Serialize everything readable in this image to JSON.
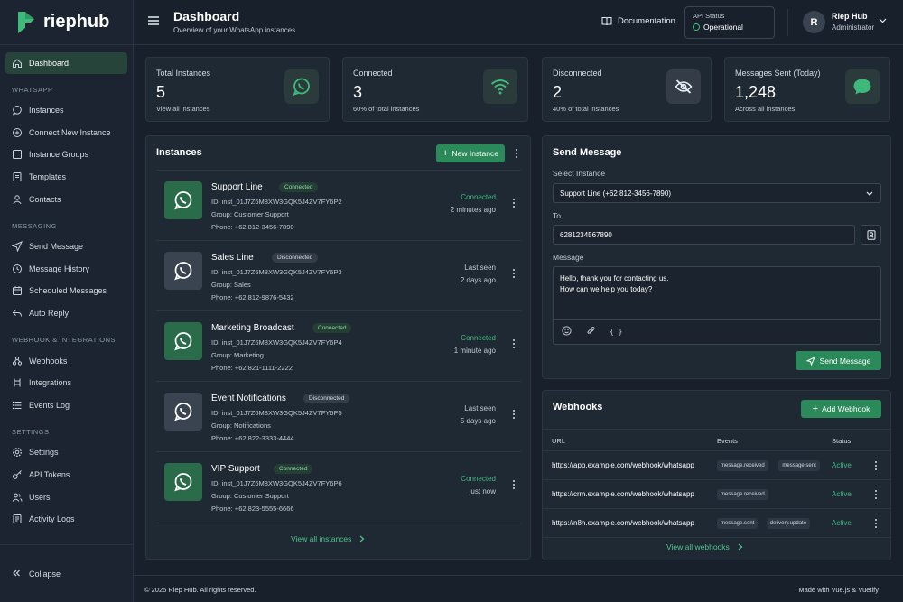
{
  "brand": {
    "name": "riephub",
    "accent": "#3fb97a"
  },
  "sidebar": {
    "items": [
      {
        "label": "Dashboard",
        "icon": "home-icon",
        "active": true
      }
    ],
    "sections": [
      {
        "title": "WHATSAPP",
        "items": [
          {
            "label": "Instances",
            "icon": "whatsapp-icon"
          },
          {
            "label": "Connect New Instance",
            "icon": "plus-circle-icon"
          },
          {
            "label": "Instance Groups",
            "icon": "folder-icon"
          },
          {
            "label": "Templates",
            "icon": "template-icon"
          },
          {
            "label": "Contacts",
            "icon": "user-icon"
          }
        ]
      },
      {
        "title": "MESSAGING",
        "items": [
          {
            "label": "Send Message",
            "icon": "send-icon"
          },
          {
            "label": "Message History",
            "icon": "history-icon"
          },
          {
            "label": "Scheduled Messages",
            "icon": "calendar-icon"
          },
          {
            "label": "Auto Reply",
            "icon": "reply-icon"
          }
        ]
      },
      {
        "title": "WEBHOOK & INTEGRATIONS",
        "items": [
          {
            "label": "Webhooks",
            "icon": "webhook-icon"
          },
          {
            "label": "Integrations",
            "icon": "integration-icon"
          },
          {
            "label": "Events Log",
            "icon": "list-icon"
          }
        ]
      },
      {
        "title": "SETTINGS",
        "items": [
          {
            "label": "Settings",
            "icon": "gear-icon"
          },
          {
            "label": "API Tokens",
            "icon": "key-icon"
          },
          {
            "label": "Users",
            "icon": "users-icon"
          },
          {
            "label": "Activity Logs",
            "icon": "log-icon"
          }
        ]
      }
    ],
    "collapse_label": "Collapse"
  },
  "header": {
    "title": "Dashboard",
    "subtitle": "Overview of your WhatsApp instances",
    "docs_label": "Documentation",
    "api_label": "API Status",
    "api_status": "Operational",
    "avatar_initial": "R",
    "user_name": "Riep Hub",
    "user_role": "Administrator"
  },
  "stats": [
    {
      "label": "Total Instances",
      "value": "5",
      "sub": "View all instances",
      "icon": "whatsapp-icon"
    },
    {
      "label": "Connected",
      "value": "3",
      "sub": "60% of total instances",
      "icon": "wifi-icon"
    },
    {
      "label": "Disconnected",
      "value": "2",
      "sub": "40% of total instances",
      "icon": "eye-off-icon"
    },
    {
      "label": "Messages Sent (Today)",
      "value": "1,248",
      "sub": "Across all instances",
      "icon": "chat-bubble-icon"
    }
  ],
  "instances": {
    "title": "Instances",
    "new_button": "New Instance",
    "view_all": "View all instances",
    "rows": [
      {
        "name": "Support Line",
        "badge": "Connected",
        "id": "ID: inst_01J7Z6M8XW3GQK5J4ZV7FY6P2",
        "group": "Group: Customer Support",
        "phone": "Phone: +62 812-3456-7890",
        "status1": "Connected",
        "status2": "2 minutes ago",
        "connected": true
      },
      {
        "name": "Sales Line",
        "badge": "Disconnected",
        "id": "ID: inst_01J7Z6M8XW3GQK5J4ZV7FY6P3",
        "group": "Group: Sales",
        "phone": "Phone: +62 812-9876-5432",
        "status1": "Last seen",
        "status2": "2 days ago",
        "connected": false
      },
      {
        "name": "Marketing Broadcast",
        "badge": "Connected",
        "id": "ID: inst_01J7Z6M8XW3GQK5J4ZV7FY6P4",
        "group": "Group: Marketing",
        "phone": "Phone: +62 821-1111-2222",
        "status1": "Connected",
        "status2": "1 minute ago",
        "connected": true
      },
      {
        "name": "Event Notifications",
        "badge": "Disconnected",
        "id": "ID: inst_01J7Z6M8XW3GQK5J4ZV7FY6P5",
        "group": "Group: Notifications",
        "phone": "Phone: +62 822-3333-4444",
        "status1": "Last seen",
        "status2": "5 days ago",
        "connected": false
      },
      {
        "name": "VIP Support",
        "badge": "Connected",
        "id": "ID: inst_01J7Z6M8XW3GQK5J4ZV7FY6P6",
        "group": "Group: Customer Support",
        "phone": "Phone: +62 823-5555-6666",
        "status1": "Connected",
        "status2": "just now",
        "connected": true
      }
    ]
  },
  "send": {
    "title": "Send Message",
    "select_label": "Select Instance",
    "select_value": "Support Line (+62 812-3456-7890)",
    "to_label": "To",
    "to_value": "6281234567890",
    "message_label": "Message",
    "message_line1": "Hello, thank you for contacting us.",
    "message_line2": "How can we help you today?",
    "braces_glyph": "{ }",
    "send_button": "Send Message"
  },
  "webhooks": {
    "title": "Webhooks",
    "add_button": "Add Webhook",
    "columns": {
      "url": "URL",
      "events": "Events",
      "status": "Status"
    },
    "rows": [
      {
        "url": "https://app.example.com/webhook/whatsapp",
        "events": [
          "message.received",
          "message.sent"
        ],
        "status": "Active"
      },
      {
        "url": "https://crm.example.com/webhook/whatsapp",
        "events": [
          "message.received"
        ],
        "status": "Active"
      },
      {
        "url": "https://n8n.example.com/webhook/whatsapp",
        "events": [
          "message.sent",
          "delivery.update"
        ],
        "status": "Active"
      }
    ],
    "view_all": "View all webhooks"
  },
  "footer": {
    "left": "© 2025 Riep Hub. All rights reserved.",
    "right": "Made with Vue.js & Vuetify"
  }
}
